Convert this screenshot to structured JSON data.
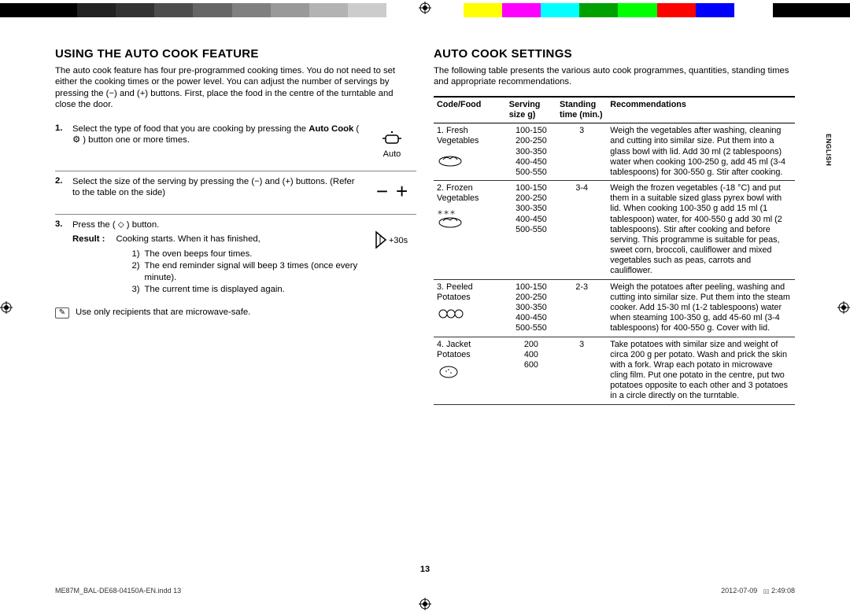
{
  "colorbar": [
    "#000000",
    "#000000",
    "#222222",
    "#333333",
    "#4d4d4d",
    "#666666",
    "#808080",
    "#999999",
    "#b3b3b3",
    "#cccccc",
    "#ffffff",
    "#ffffff",
    "#ffff00",
    "#ff00ff",
    "#00ffff",
    "#00a000",
    "#00ff00",
    "#ff0000",
    "#0000ff",
    "#ffffff",
    "#000000",
    "#000000"
  ],
  "lang": "ENGLISH",
  "pagenum": "13",
  "footer": {
    "left": "ME87M_BAL-DE68-04150A-EN.indd   13",
    "right_date": "2012-07-09",
    "right_time": "2:49:08"
  },
  "left": {
    "title": "USING THE AUTO COOK FEATURE",
    "intro": "The auto cook feature has four pre-programmed cooking times. You do not need to set either the cooking times or the power level. You can adjust the number of servings by pressing the (−) and (+) buttons. First, place the food in the centre of the turntable and close the door.",
    "step1_pre": "Select the type of food that you are cooking by pressing the ",
    "step1_bold": "Auto Cook",
    "step1_post": " ( ⚙ ) button one or more times.",
    "fig1_label": "Auto",
    "step2": "Select the size of the serving by pressing the (−) and (+) buttons. (Refer to the table on the side)",
    "step3": "Press the ( ⬦ ) button.",
    "result_label": "Result :",
    "result_text": "Cooking starts. When it has finished,",
    "sub1": "The oven beeps four times.",
    "sub2": "The end reminder signal will beep 3 times (once every minute).",
    "sub3": "The current time is displayed again.",
    "fig3_label": "+30s",
    "note": "Use only recipients that are microwave-safe."
  },
  "right": {
    "title": "AUTO COOK SETTINGS",
    "intro": "The following table presents the various auto cook programmes, quantities, standing times and appropriate recommendations.",
    "th1": "Code/Food",
    "th2a": "Serving",
    "th2b": "size g)",
    "th3a": "Standing",
    "th3b": "time (min.)",
    "th4": "Recommendations",
    "rows": [
      {
        "food": "1. Fresh\nVegetables",
        "serv": "100-150\n200-250\n300-350\n400-450\n500-550",
        "stand": "3",
        "rec": "Weigh the vegetables after washing, cleaning and cutting into similar size. Put them into a glass bowl with lid. Add 30 ml (2 tablespoons) water when cooking 100-250 g, add 45 ml (3-4 tablespoons) for 300-550 g. Stir after cooking."
      },
      {
        "food": "2. Frozen\nVegetables",
        "serv": "100-150\n200-250\n300-350\n400-450\n500-550",
        "stand": "3-4",
        "rec": "Weigh the frozen vegetables (-18 °C) and put them in a suitable sized glass pyrex bowl with lid. When cooking 100-350 g add 15 ml (1 tablespoon) water, for 400-550 g add 30 ml (2 tablespoons). Stir after cooking and before serving. This programme is suitable for peas, sweet corn, broccoli, cauliflower and mixed vegetables such as peas, carrots and cauliflower."
      },
      {
        "food": "3. Peeled\nPotatoes",
        "serv": "100-150\n200-250\n300-350\n400-450\n500-550",
        "stand": "2-3",
        "rec": "Weigh the potatoes after peeling, washing and cutting into similar size. Put them into the steam cooker. Add 15-30 ml (1-2 tablespoons) water when steaming 100-350 g, add 45-60 ml (3-4 tablespoons) for 400-550 g. Cover with lid."
      },
      {
        "food": "4. Jacket\nPotatoes",
        "serv": "200\n400\n600",
        "stand": "3",
        "rec": "Take potatoes with similar size and weight of circa 200 g per potato. Wash and prick the skin with a fork. Wrap each potato in microwave cling film. Put one potato in the centre, put two potatoes opposite to each other and 3 potatoes in a circle directly on the turntable."
      }
    ]
  }
}
